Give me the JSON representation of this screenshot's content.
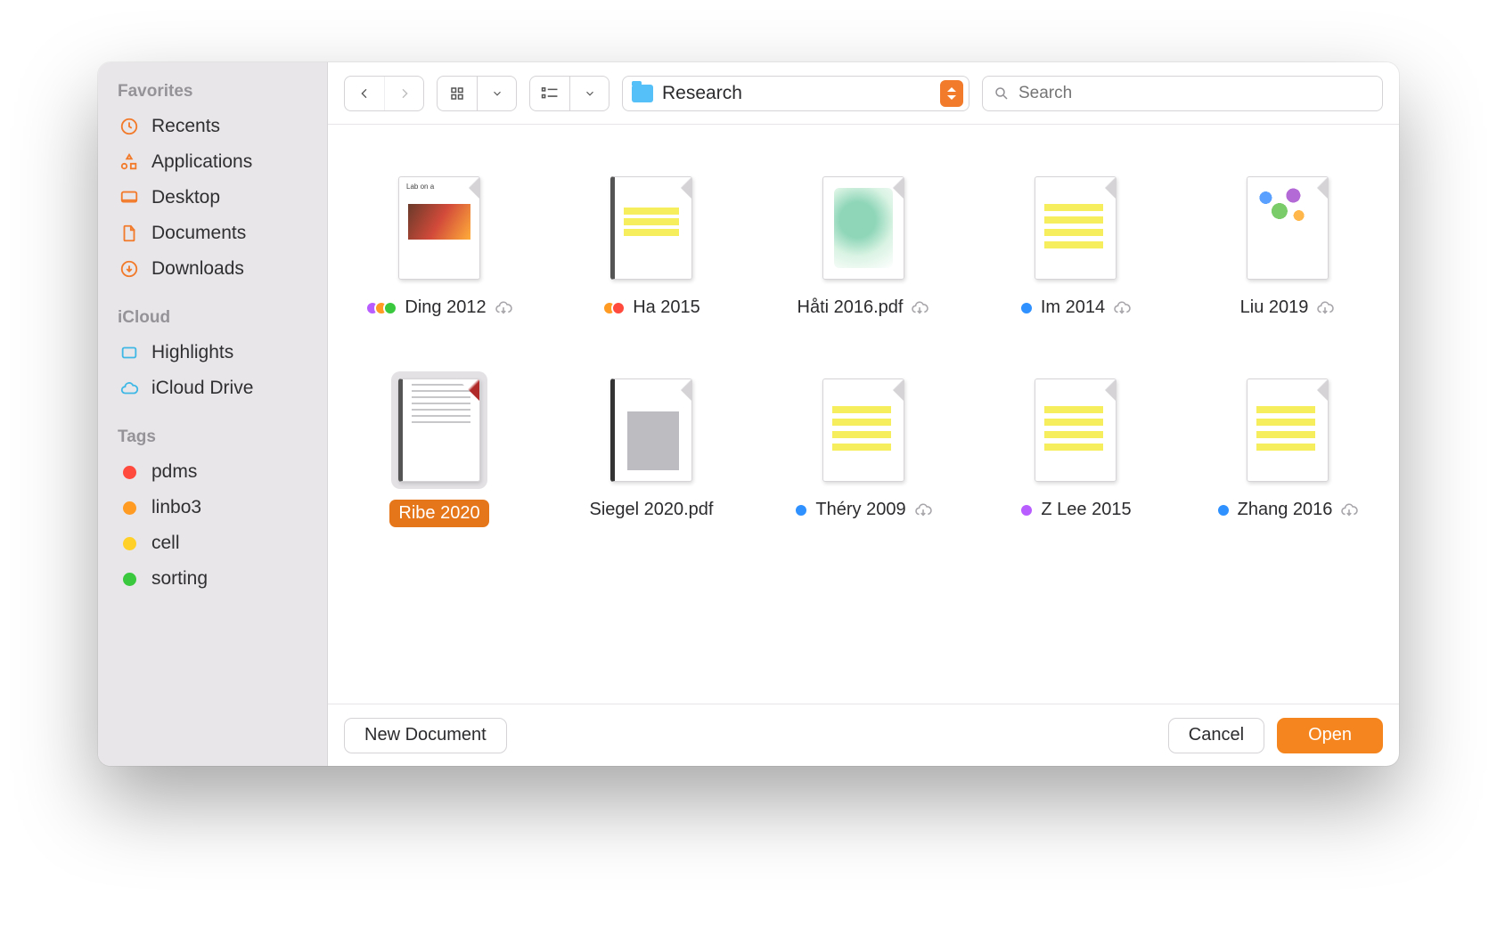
{
  "sidebar": {
    "sections": [
      {
        "label": "Favorites",
        "items": [
          {
            "icon": "clock-icon",
            "label": "Recents"
          },
          {
            "icon": "apps-icon",
            "label": "Applications"
          },
          {
            "icon": "desktop-icon",
            "label": "Desktop"
          },
          {
            "icon": "doc-icon",
            "label": "Documents"
          },
          {
            "icon": "download-icon",
            "label": "Downloads"
          }
        ]
      },
      {
        "label": "iCloud",
        "items": [
          {
            "icon": "highlights-icon",
            "label": "Highlights",
            "iconColor": "#3fb8e6"
          },
          {
            "icon": "cloud-icon",
            "label": "iCloud Drive",
            "iconColor": "#3fb8e6"
          }
        ]
      },
      {
        "label": "Tags",
        "items": [
          {
            "dot": "red",
            "label": "pdms"
          },
          {
            "dot": "orange",
            "label": "linbo3"
          },
          {
            "dot": "yellow",
            "label": "cell"
          },
          {
            "dot": "green",
            "label": "sorting"
          }
        ]
      }
    ]
  },
  "toolbar": {
    "path_label": "Research",
    "search_placeholder": "Search"
  },
  "files": [
    {
      "name": "Ding 2012",
      "tags": [
        "purple",
        "orange",
        "green"
      ],
      "cloud": true,
      "thumb": "labona-band",
      "selected": false
    },
    {
      "name": "Ha 2015",
      "tags": [
        "orange",
        "red"
      ],
      "cloud": false,
      "thumb": "sci-highlight",
      "selected": false
    },
    {
      "name": "Håti 2016.pdf",
      "tags": [],
      "cloud": true,
      "thumb": "bio-chip",
      "selected": false
    },
    {
      "name": "Im 2014",
      "tags": [
        "blue"
      ],
      "cloud": true,
      "thumb": "highlight-a",
      "selected": false
    },
    {
      "name": "Liu 2019",
      "tags": [],
      "cloud": true,
      "thumb": "dots",
      "selected": false
    },
    {
      "name": "Ribe 2020",
      "tags": [],
      "cloud": false,
      "thumb": "spine-red",
      "selected": true
    },
    {
      "name": "Siegel 2020.pdf",
      "tags": [],
      "cloud": false,
      "thumb": "striped-grey",
      "selected": false
    },
    {
      "name": "Théry 2009",
      "tags": [
        "blue"
      ],
      "cloud": true,
      "thumb": "highlight-b",
      "selected": false
    },
    {
      "name": "Z Lee 2015",
      "tags": [
        "purple"
      ],
      "cloud": false,
      "thumb": "highlight-c",
      "selected": false
    },
    {
      "name": "Zhang 2016",
      "tags": [
        "blue"
      ],
      "cloud": true,
      "thumb": "highlight-d",
      "selected": false
    }
  ],
  "footer": {
    "new_doc": "New Document",
    "cancel": "Cancel",
    "open": "Open"
  }
}
